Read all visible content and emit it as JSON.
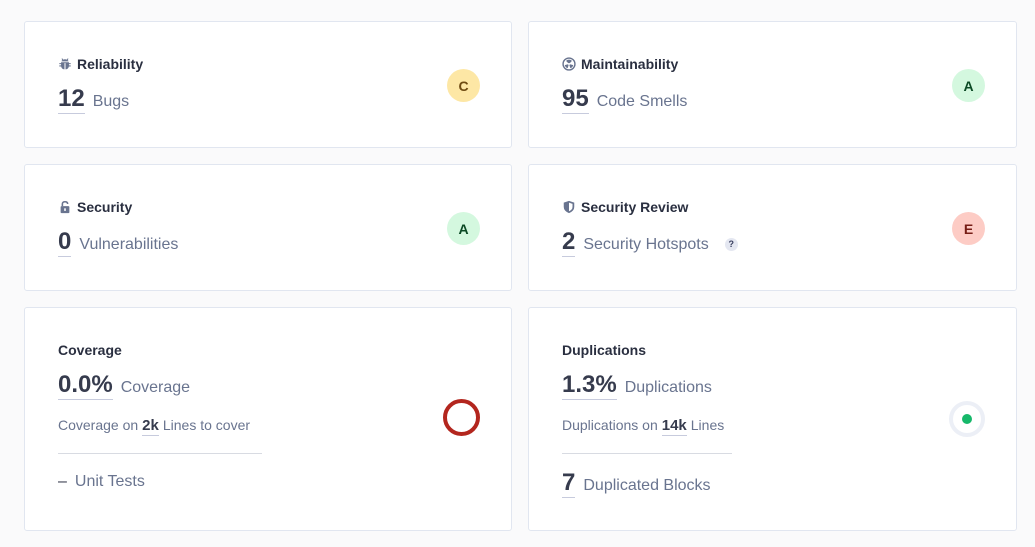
{
  "cards": {
    "reliability": {
      "title": "Reliability",
      "icon": "bug-icon",
      "value": "12",
      "label": "Bugs",
      "rating": "C",
      "rating_color": "#fde7a5"
    },
    "maintainability": {
      "title": "Maintainability",
      "icon": "code-smell-icon",
      "value": "95",
      "label": "Code Smells",
      "rating": "A",
      "rating_color": "#d4f8df"
    },
    "security": {
      "title": "Security",
      "icon": "lock-icon",
      "value": "0",
      "label": "Vulnerabilities",
      "rating": "A",
      "rating_color": "#d4f8df"
    },
    "security_review": {
      "title": "Security Review",
      "icon": "shield-icon",
      "value": "2",
      "label": "Security Hotspots",
      "help": "?",
      "rating": "E",
      "rating_color": "#fdccc5"
    },
    "coverage": {
      "title": "Coverage",
      "value": "0.0%",
      "label": "Coverage",
      "sub_prefix": "Coverage on",
      "sub_value": "2k",
      "sub_suffix": "Lines to cover",
      "unit_tests_dash": "–",
      "unit_tests_label": "Unit Tests",
      "indicator_color": "#b3261e",
      "coverage_percent": 0.0
    },
    "duplications": {
      "title": "Duplications",
      "value": "1.3%",
      "label": "Duplications",
      "sub_prefix": "Duplications on",
      "sub_value": "14k",
      "sub_suffix": "Lines",
      "blocks_value": "7",
      "blocks_label": "Duplicated Blocks",
      "indicator_color": "#16b86a",
      "duplication_percent": 1.3
    }
  }
}
